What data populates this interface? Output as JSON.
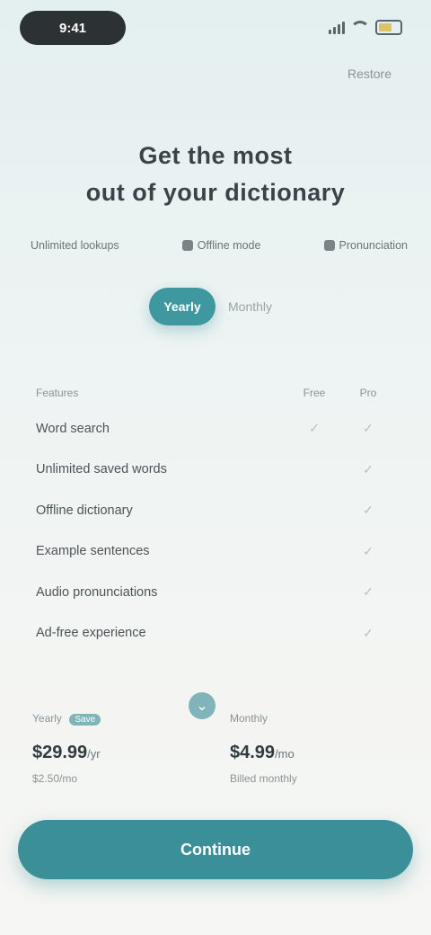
{
  "status_bar": {
    "time": "9:41"
  },
  "header": {
    "restore_label": "Restore"
  },
  "headline": {
    "line1": "Get the most",
    "line2": "out of your dictionary"
  },
  "features": [
    {
      "label": "Unlimited lookups"
    },
    {
      "label": "Offline mode"
    },
    {
      "label": "Pronunciation"
    }
  ],
  "billing_toggle": {
    "active": "Yearly",
    "inactive": "Monthly"
  },
  "comparison": {
    "header_feature": "Features",
    "header_free": "Free",
    "header_pro": "Pro",
    "rows": [
      {
        "label": "Word search",
        "free": "✓",
        "pro": "✓"
      },
      {
        "label": "Unlimited saved words",
        "free": "",
        "pro": "✓"
      },
      {
        "label": "Offline dictionary",
        "free": "",
        "pro": "✓"
      },
      {
        "label": "Example sentences",
        "free": "",
        "pro": "✓"
      },
      {
        "label": "Audio pronunciations",
        "free": "",
        "pro": "✓"
      },
      {
        "label": "Ad-free experience",
        "free": "",
        "pro": "✓"
      }
    ]
  },
  "plans": [
    {
      "name": "Yearly",
      "badge": "Save",
      "price": "$29.99",
      "period": "/yr",
      "sub": "$2.50/mo"
    },
    {
      "name": "Monthly",
      "badge": "",
      "price": "$4.99",
      "period": "/mo",
      "sub": "Billed monthly"
    }
  ],
  "cta": {
    "label": "Continue"
  },
  "colors": {
    "accent": "#3a8f98",
    "accent_light": "#7fb4bb"
  }
}
